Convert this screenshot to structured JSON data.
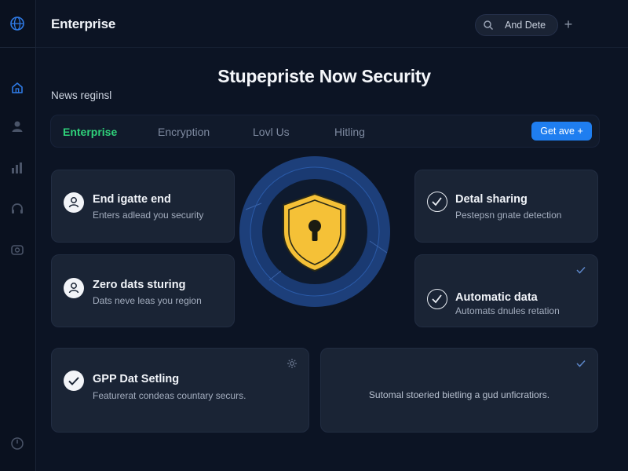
{
  "header": {
    "brand": "Enterprise",
    "search_label": "And Dete",
    "plus_label": "+"
  },
  "page": {
    "title": "Stupepriste Now Security",
    "subtitle": "News reginsl"
  },
  "tabs": [
    {
      "label": "Enterprise",
      "active": true
    },
    {
      "label": "Encryption",
      "active": false
    },
    {
      "label": "Lovl Us",
      "active": false
    },
    {
      "label": "Hitling",
      "active": false
    }
  ],
  "cta_label": "Get ave +",
  "cards": {
    "card1": {
      "title": "End igatte end",
      "desc": "Enters adlead you security",
      "icon": "user-lock-icon"
    },
    "card2": {
      "title": "Zero dats sturing",
      "desc": "Dats neve leas you region",
      "icon": "user-lock-icon"
    },
    "card3": {
      "title": "Detal sharing",
      "desc": "Pestepsn gnate detection",
      "icon": "check-circle-icon"
    },
    "card4": {
      "title": "Automatic data",
      "desc": "Automats dnules retation",
      "icon": "check-circle-icon"
    },
    "card5": {
      "title": "GPP Dat Setling",
      "desc": "Featurerat condeas countary securs.",
      "icon": "check-circle-icon"
    },
    "card6": {
      "desc": "Sutomal stoeried bietling a gud unficratiors."
    }
  },
  "sidebar": {
    "items": [
      "home-icon",
      "user-icon",
      "chart-icon",
      "headset-icon",
      "gamepad-icon",
      "power-icon"
    ]
  },
  "colors": {
    "accent_blue": "#1f7ef0",
    "accent_green": "#2fd17a",
    "shield_yellow": "#f5c137",
    "background": "#0c1424"
  }
}
